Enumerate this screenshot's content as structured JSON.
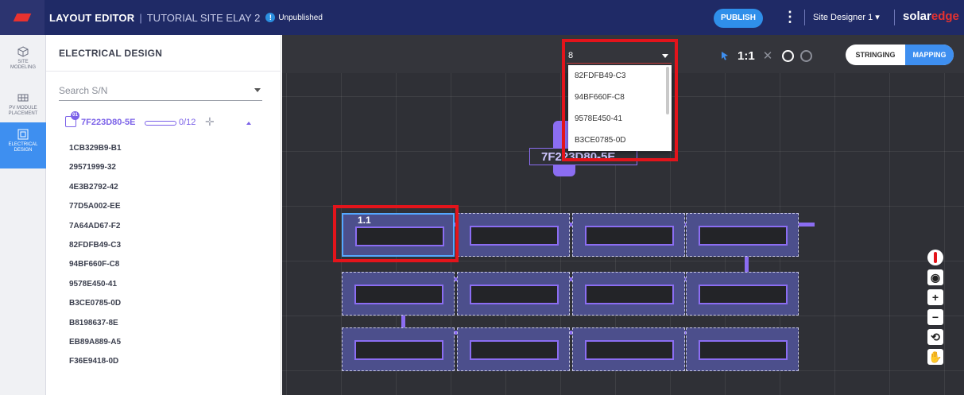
{
  "header": {
    "app_title": "LAYOUT EDITOR",
    "separator": "|",
    "site_title": "TUTORIAL SITE ELAY 2",
    "info_glyph": "!",
    "status": "Unpublished",
    "publish_label": "PUBLISH",
    "kebab": "⋮",
    "designer_label": "Site Designer 1 ▾",
    "brand_solar": "solar",
    "brand_edge": "edge",
    "brand_color": "#e8322f",
    "bar_color": "#1f2a66"
  },
  "rail": {
    "items": [
      {
        "label": "SITE\nMODELING",
        "icon": "cube-icon"
      },
      {
        "label": "PV MODULE\nPLACEMENT",
        "icon": "grid-icon"
      },
      {
        "label": "ELECTRICAL\nDESIGN",
        "icon": "chip-icon",
        "active": true
      }
    ],
    "active_color": "#3e8ff0"
  },
  "sidebar": {
    "title": "ELECTRICAL DESIGN",
    "search_placeholder": "Search S/N",
    "inverter": {
      "badge": "01",
      "id": "7F223D80-5E",
      "count": "0/12",
      "crosshair": "✛",
      "color": "#7b61e8"
    },
    "serials": [
      "1CB329B9-B1",
      "29571999-32",
      "4E3B2792-42",
      "77D5A002-EE",
      "7A64AD67-F2",
      "82FDFB49-C3",
      "94BF660F-C8",
      "9578E450-41",
      "B3CE0785-0D",
      "B8198637-8E",
      "EB89A889-A5",
      "F36E9418-0D"
    ]
  },
  "canvas": {
    "sn_input_value": "8",
    "dropdown_options": [
      "82FDFB49-C3",
      "94BF660F-C8",
      "9578E450-41",
      "B3CE0785-0D"
    ],
    "inverter_label": "7F223D80-5E",
    "selected_panel_label": "1.1",
    "tools": {
      "ratio": "1:1",
      "close": "✕"
    },
    "modes": {
      "stringing": "STRINGING",
      "mapping": "MAPPING",
      "active": "MAPPING"
    },
    "nav": {
      "plus": "+",
      "minus": "−"
    },
    "highlight_color": "#e3141b",
    "string_color": "#8b6df2"
  }
}
